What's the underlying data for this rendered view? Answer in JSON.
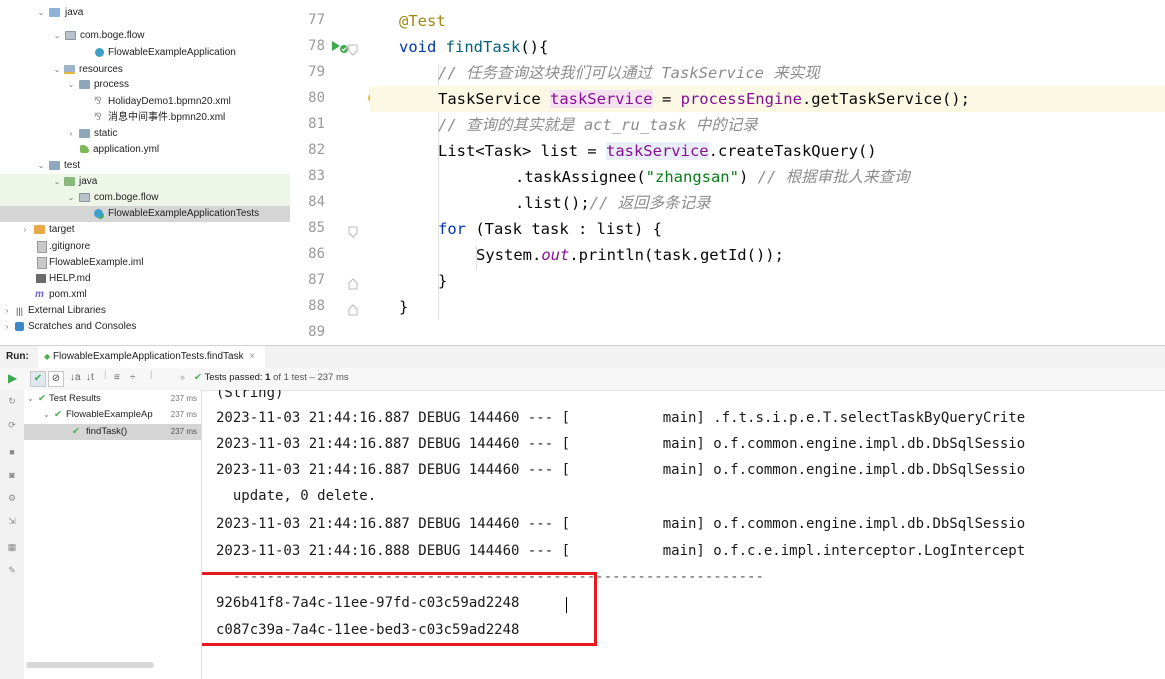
{
  "project_tree": {
    "items": [
      {
        "label": "java"
      },
      {
        "label": "com.boge.flow"
      },
      {
        "label": "FlowableExampleApplication"
      },
      {
        "label": "resources"
      },
      {
        "label": "process"
      },
      {
        "label": "HolidayDemo1.bpmn20.xml"
      },
      {
        "label": "消息中间事件.bpmn20.xml"
      },
      {
        "label": "static"
      },
      {
        "label": "application.yml"
      },
      {
        "label": "test"
      },
      {
        "label": "java"
      },
      {
        "label": "com.boge.flow"
      },
      {
        "label": "FlowableExampleApplicationTests"
      },
      {
        "label": "target"
      },
      {
        "label": ".gitignore"
      },
      {
        "label": "FlowableExample.iml"
      },
      {
        "label": "HELP.md"
      },
      {
        "label": "pom.xml"
      },
      {
        "label": "External Libraries"
      },
      {
        "label": "Scratches and Consoles"
      }
    ]
  },
  "editor": {
    "line_numbers": [
      "77",
      "78",
      "79",
      "80",
      "81",
      "82",
      "83",
      "84",
      "85",
      "86",
      "87",
      "88",
      "89"
    ],
    "code": {
      "l77": "@Test",
      "l78_kw": "void",
      "l78_fn": "findTask",
      "l78_rest": "(){",
      "l79": "// 任务查询这块我们可以通过 TaskService 来实现",
      "l80_type": "TaskService ",
      "l80_var": "taskService",
      "l80_eq": " = ",
      "l80_pe": "processEngine",
      "l80_rest": ".getTaskService();",
      "l81": "// 查询的其实就是 act_ru_task 中的记录",
      "l82_a": "List<Task> list = ",
      "l82_var": "taskService",
      "l82_rest": ".createTaskQuery()",
      "l83_a": ".taskAssignee(",
      "l83_str": "\"zhangsan\"",
      "l83_b": ") ",
      "l83_cm": "// 根据审批人来查询",
      "l84_a": ".list();",
      "l84_cm": "// 返回多条记录",
      "l85_kw": "for",
      "l85_rest": " (Task task : list) {",
      "l86_a": "System.",
      "l86_out": "out",
      "l86_rest": ".println(task.getId());",
      "l87": "}",
      "l88": "}",
      "l89": "}"
    }
  },
  "run": {
    "label": "Run:",
    "tab": "FlowableExampleApplicationTests.findTask",
    "status_prefix": "Tests passed:",
    "status_count": "1",
    "status_rest": "of 1 test – 237 ms",
    "tree": [
      {
        "label": "Test Results",
        "time": "237 ms"
      },
      {
        "label": "FlowableExampleAp",
        "time": "237 ms"
      },
      {
        "label": "findTask()",
        "time": "237 ms"
      }
    ]
  },
  "console": {
    "lines": [
      "(String)",
      "2023-11-03 21:44:16.887 DEBUG 144460 --- [           main] .f.t.s.i.p.e.T.selectTaskByQueryCrite",
      "2023-11-03 21:44:16.887 DEBUG 144460 --- [           main] o.f.common.engine.impl.db.DbSqlSessio",
      "2023-11-03 21:44:16.887 DEBUG 144460 --- [           main] o.f.common.engine.impl.db.DbSqlSessio",
      "  update, 0 delete.",
      "2023-11-03 21:44:16.887 DEBUG 144460 --- [           main] o.f.common.engine.impl.db.DbSqlSessio",
      "2023-11-03 21:44:16.888 DEBUG 144460 --- [           main] o.f.c.e.impl.interceptor.LogIntercept",
      "  ---------------------------------------------------------------",
      "926b41f8-7a4c-11ee-97fd-c03c59ad2248",
      "c087c39a-7a4c-11ee-bed3-c03c59ad2248"
    ]
  },
  "colors": {
    "highlight_box": "#e8191d",
    "pass_green": "#4caf50"
  }
}
